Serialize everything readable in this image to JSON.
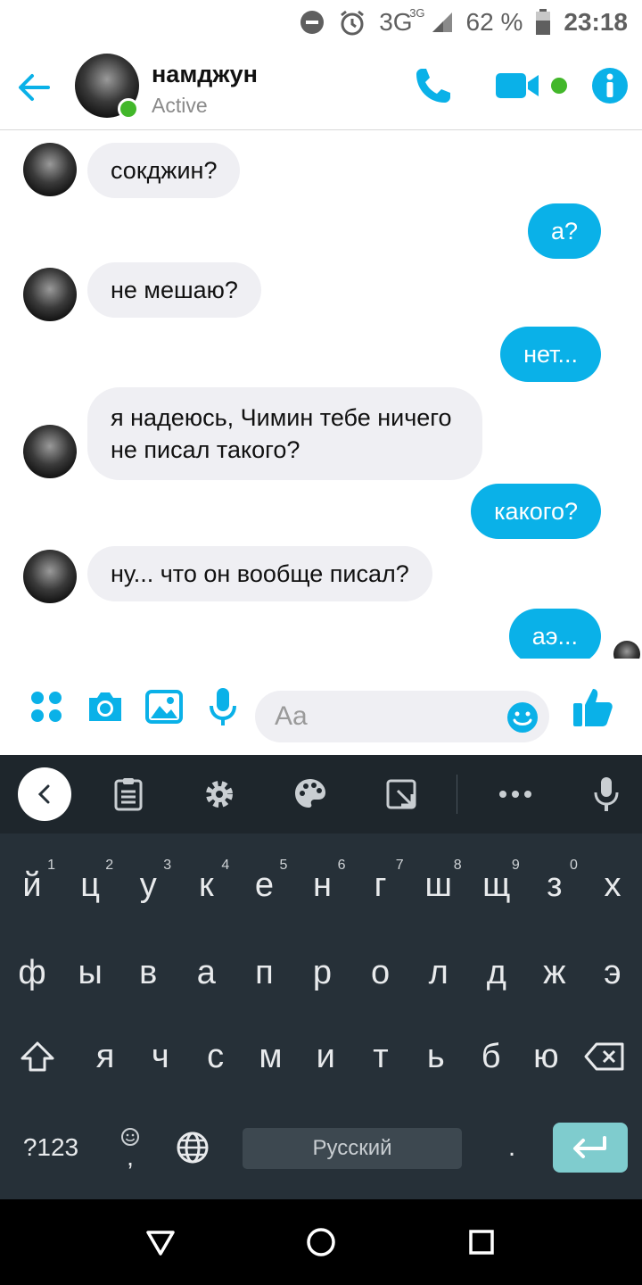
{
  "status_bar": {
    "network": "3G",
    "network_sup": "3G",
    "battery": "62 %",
    "time": "23:18"
  },
  "header": {
    "name": "намджун",
    "status": "Active",
    "accent_color": "#0ab1e8",
    "online_color": "#42b72a"
  },
  "messages": [
    {
      "direction": "in",
      "text": "сокджин?"
    },
    {
      "direction": "out",
      "text": "а?"
    },
    {
      "direction": "in",
      "text": "не мешаю?"
    },
    {
      "direction": "out",
      "text": "нет..."
    },
    {
      "direction": "in",
      "text": "я надеюсь, Чимин тебе ничего\nне писал такого?"
    },
    {
      "direction": "out",
      "text": "какого?"
    },
    {
      "direction": "in",
      "text": "ну... что он вообще писал?"
    },
    {
      "direction": "out",
      "text": "аэ..."
    }
  ],
  "composer": {
    "placeholder": "Aa"
  },
  "keyboard": {
    "row1": [
      "й",
      "ц",
      "у",
      "к",
      "е",
      "н",
      "г",
      "ш",
      "щ",
      "з",
      "х"
    ],
    "row1_hints": [
      "1",
      "2",
      "3",
      "4",
      "5",
      "6",
      "7",
      "8",
      "9",
      "0",
      ""
    ],
    "row2": [
      "ф",
      "ы",
      "в",
      "а",
      "п",
      "р",
      "о",
      "л",
      "д",
      "ж",
      "э"
    ],
    "row3": [
      "я",
      "ч",
      "с",
      "м",
      "и",
      "т",
      "ь",
      "б",
      "ю"
    ],
    "symbols_label": "?123",
    "comma_label": ",",
    "space_label": "Русский",
    "period_label": "."
  }
}
